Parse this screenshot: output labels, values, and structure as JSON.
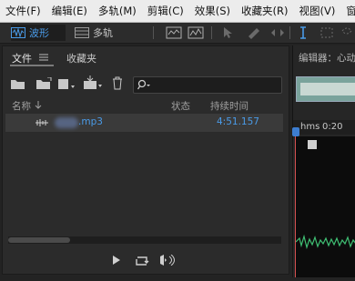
{
  "menubar": {
    "items": [
      "文件(F)",
      "编辑(E)",
      "多轨(M)",
      "剪辑(C)",
      "效果(S)",
      "收藏夹(R)",
      "视图(V)",
      "窗"
    ]
  },
  "toolbar": {
    "waveform_label": "波形",
    "multitrack_label": "多轨"
  },
  "files_panel": {
    "tab_files": "文件",
    "tab_favorites": "收藏夹",
    "search_placeholder": "",
    "columns": {
      "name": "名称",
      "status": "状态",
      "duration": "持续时间"
    },
    "rows": [
      {
        "name": ".mp3",
        "status": "",
        "duration": "4:51.157"
      }
    ]
  },
  "editor_panel": {
    "title": "编辑器：心动",
    "ruler_unit": "hms",
    "ruler_time": "0:20"
  },
  "colors": {
    "accent": "#4a9be8",
    "waveform": "#3fbf73",
    "playhead": "#d65050"
  }
}
